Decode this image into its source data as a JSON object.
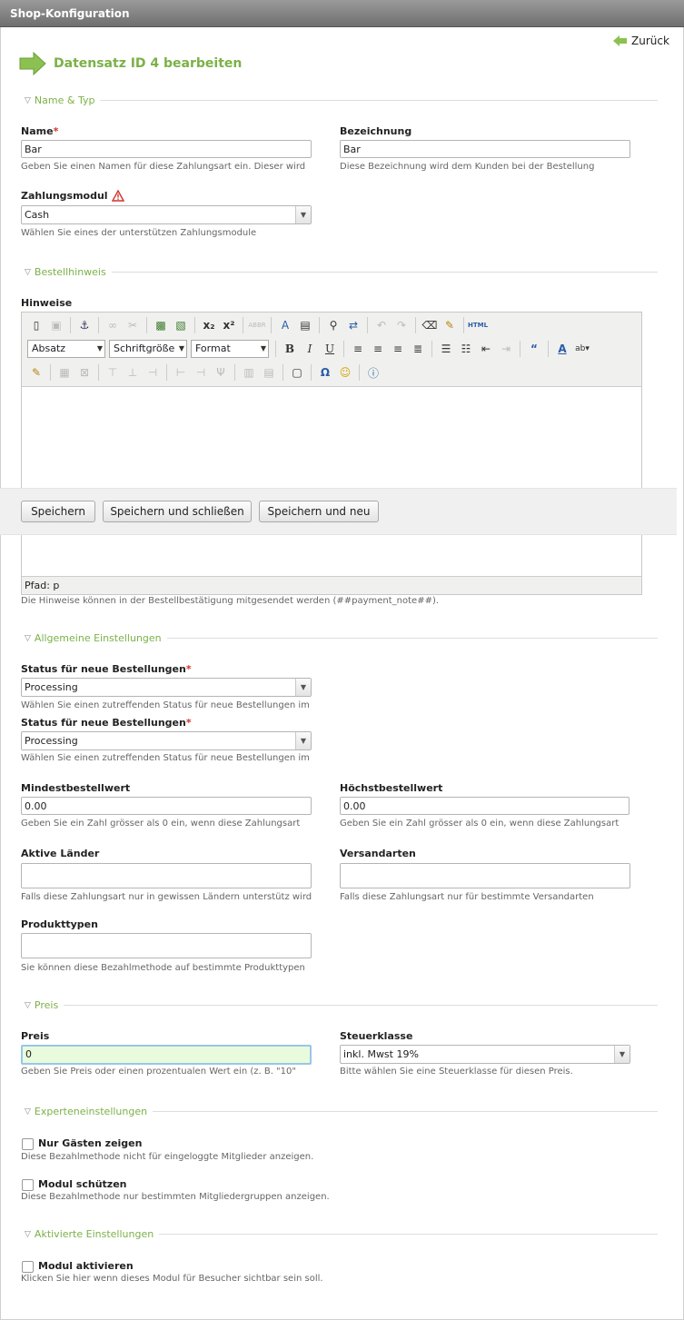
{
  "window_title": "Shop-Konfiguration",
  "back_label": "Zurück",
  "page_title": "Datensatz ID 4 bearbeiten",
  "sections": {
    "name_typ": "Name & Typ",
    "bestellhinweis": "Bestellhinweis",
    "allgemein": "Allgemeine Einstellungen",
    "preis": "Preis",
    "experten": "Experteneinstellungen",
    "aktiviert": "Aktivierte Einstellungen"
  },
  "fields": {
    "name": {
      "label": "Name",
      "value": "Bar",
      "hint": "Geben Sie einen Namen für diese Zahlungsart ein. Dieser wird"
    },
    "bezeichnung": {
      "label": "Bezeichnung",
      "value": "Bar",
      "hint": "Diese Bezeichnung wird dem Kunden bei der Bestellung"
    },
    "zahlungsmodul": {
      "label": "Zahlungsmodul",
      "value": "Cash",
      "hint": "Wählen Sie eines der unterstützen Zahlungsmodule"
    },
    "hinweise": {
      "label": "Hinweise",
      "path": "Pfad: p",
      "hint": "Die Hinweise können in der Bestellbestätigung mitgesendet werden (##payment_note##)."
    },
    "status1": {
      "label": "Status für neue Bestellungen",
      "value": "Processing",
      "hint": "Wählen Sie einen zutreffenden Status für neue Bestellungen im"
    },
    "status2": {
      "label": "Status für neue Bestellungen",
      "value": "Processing",
      "hint": "Wählen Sie einen zutreffenden Status für neue Bestellungen im"
    },
    "mindest": {
      "label": "Mindestbestellwert",
      "value": "0.00",
      "hint": "Geben Sie ein Zahl grösser als 0 ein, wenn diese Zahlungsart"
    },
    "hoechst": {
      "label": "Höchstbestellwert",
      "value": "0.00",
      "hint": "Geben Sie ein Zahl grösser als 0 ein, wenn diese Zahlungsart"
    },
    "laender": {
      "label": "Aktive Länder",
      "value": "",
      "hint": "Falls diese Zahlungsart nur in gewissen Ländern unterstütz wird"
    },
    "versand": {
      "label": "Versandarten",
      "value": "",
      "hint": "Falls diese Zahlungsart nur für bestimmte Versandarten"
    },
    "produkt": {
      "label": "Produkttypen",
      "value": "",
      "hint": "Sie können diese Bezahlmethode auf bestimmte Produkttypen"
    },
    "preis": {
      "label": "Preis",
      "value": "0",
      "hint": "Geben Sie Preis oder einen prozentualen Wert ein (z. B. \"10\""
    },
    "steuer": {
      "label": "Steuerklasse",
      "value": "inkl. Mwst 19%",
      "hint": "Bitte wählen Sie eine Steuerklasse für diesen Preis."
    },
    "gaeste": {
      "label": "Nur Gästen zeigen",
      "hint": "Diese Bezahlmethode nicht für eingeloggte Mitglieder anzeigen."
    },
    "schuetzen": {
      "label": "Modul schützen",
      "hint": "Diese Bezahlmethode nur bestimmten Mitgliedergruppen anzeigen."
    },
    "aktivieren": {
      "label": "Modul aktivieren",
      "hint": "Klicken Sie hier wenn dieses Modul für Besucher sichtbar sein soll."
    }
  },
  "editor": {
    "block_select": "Absatz",
    "size_select": "Schriftgröße",
    "format_select": "Format"
  },
  "buttons": {
    "save": "Speichern",
    "save_close": "Speichern und schließen",
    "save_new": "Speichern und neu"
  },
  "colors": {
    "accent": "#7bb148",
    "required": "#d2322d"
  }
}
